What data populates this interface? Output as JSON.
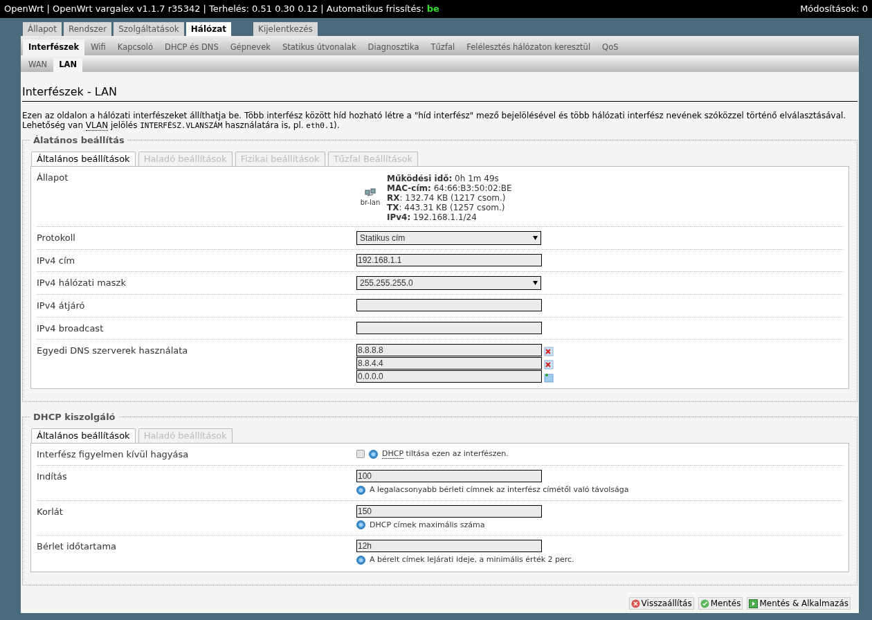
{
  "header": {
    "title": "OpenWrt | OpenWrt vargalex v1.1.7 r35342 | Terhelés: 0.51 0.30 0.12 | Automatikus frissítés: ",
    "refresh_state": "be",
    "changes": "Módosítások: 0"
  },
  "main_tabs": [
    {
      "label": "Állapot",
      "selected": false
    },
    {
      "label": "Rendszer",
      "selected": false
    },
    {
      "label": "Szolgáltatások",
      "selected": false
    },
    {
      "label": "Hálózat",
      "selected": true
    },
    {
      "label": "Kijelentkezés",
      "selected": false,
      "kind": "logout"
    }
  ],
  "sub_tabs": [
    {
      "label": "Interfészek",
      "selected": true
    },
    {
      "label": "Wifi",
      "selected": false
    },
    {
      "label": "Kapcsoló",
      "selected": false
    },
    {
      "label": "DHCP és DNS",
      "selected": false
    },
    {
      "label": "Gépnevek",
      "selected": false
    },
    {
      "label": "Statikus útvonalak",
      "selected": false
    },
    {
      "label": "Diagnosztika",
      "selected": false
    },
    {
      "label": "Tűzfal",
      "selected": false
    },
    {
      "label": "Felélesztés hálózaton keresztül",
      "selected": false
    },
    {
      "label": "QoS",
      "selected": false
    }
  ],
  "iface_tabs": [
    {
      "label": "WAN",
      "selected": false
    },
    {
      "label": "LAN",
      "selected": true
    }
  ],
  "page_title": "Interfészek - LAN",
  "description": [
    {
      "kind": "text",
      "text": "Ezen az oldalon a hálózati interfészeket állíthatja be. Több interfész között híd hozható létre a \"híd interfész\" mező bejelölésével és több hálózati interfész nevének szóközzel történő elválasztásával. Lehetőség van "
    },
    {
      "kind": "abbr",
      "text": "VLAN"
    },
    {
      "kind": "text",
      "text": " jelölés "
    },
    {
      "kind": "code",
      "text": "INTERFÉSZ.VLANSZÁM"
    },
    {
      "kind": "text",
      "text": " használatára is, pl. "
    },
    {
      "kind": "code",
      "text": "eth0.1"
    },
    {
      "kind": "text",
      "text": ")."
    }
  ],
  "sections": [
    {
      "legend": "Álatános beállítás",
      "tabs": [
        {
          "label": "Általános beállítások",
          "selected": true
        },
        {
          "label": "Haladó beállítások",
          "selected": false
        },
        {
          "label": "Fizikai beállítások",
          "selected": false
        },
        {
          "label": "Tűzfal Beállítások",
          "selected": false
        }
      ],
      "rows": [
        {
          "kind": "status",
          "label": "Állapot",
          "device": "br-lan",
          "lines": [
            "**Működési idő:** 0h 1m 49s",
            "**MAC-cím:** 64:66:B3:50:02:BE",
            "**RX**: 132.74 KB (1217 csom.)",
            "**TX**: 443.31 KB (1257 csom.)",
            "**IPv4:** 192.168.1.1/24"
          ]
        },
        {
          "kind": "select",
          "label": "Protokoll",
          "value": "Statikus cím"
        },
        {
          "kind": "text",
          "label": "IPv4 cím",
          "value": "192.168.1.1"
        },
        {
          "kind": "select",
          "label": "IPv4 hálózati maszk",
          "value": "255.255.255.0"
        },
        {
          "kind": "text",
          "label": "IPv4 átjáró"
        },
        {
          "kind": "text",
          "label": "IPv4 broadcast"
        },
        {
          "kind": "dynlist",
          "label": "Egyedi DNS szerverek használata",
          "items": [
            {
              "value": "8.8.8.8",
              "kind": "remove"
            },
            {
              "value": "8.8.4.4",
              "kind": "remove"
            },
            {
              "value": "0.0.0.0",
              "kind": "add"
            }
          ]
        }
      ]
    },
    {
      "legend": "DHCP kiszolgáló",
      "tabs": [
        {
          "label": "Általános beállítások",
          "selected": true
        },
        {
          "label": "Haladó beállítások",
          "selected": false
        }
      ],
      "rows": [
        {
          "kind": "checkbox",
          "label": "Interfész figyelmen kívül hagyása",
          "checked": false,
          "hint": [
            {
              "kind": "abbr",
              "text": "DHCP"
            },
            {
              "kind": "text",
              "text": " tiltása ezen az interfészen."
            }
          ]
        },
        {
          "kind": "text",
          "label": "Indítás",
          "value": "100",
          "hint": [
            {
              "kind": "text",
              "text": "A legalacsonyabb bérleti címnek az interfész címétől való távolsága"
            }
          ]
        },
        {
          "kind": "text",
          "label": "Korlát",
          "value": "150",
          "hint": [
            {
              "kind": "text",
              "text": "DHCP címek maximális száma"
            }
          ]
        },
        {
          "kind": "text",
          "label": "Bérlet időtartama",
          "value": "12h",
          "hint": [
            {
              "kind": "text",
              "text": "A bérelt címek lejárati ideje, a minimális érték 2 perc."
            }
          ]
        }
      ]
    }
  ],
  "buttons": [
    {
      "label": "Visszaállítás",
      "kind": "reset"
    },
    {
      "label": "Mentés",
      "kind": "save"
    },
    {
      "label": "Mentés & Alkalmazás",
      "kind": "apply"
    }
  ]
}
